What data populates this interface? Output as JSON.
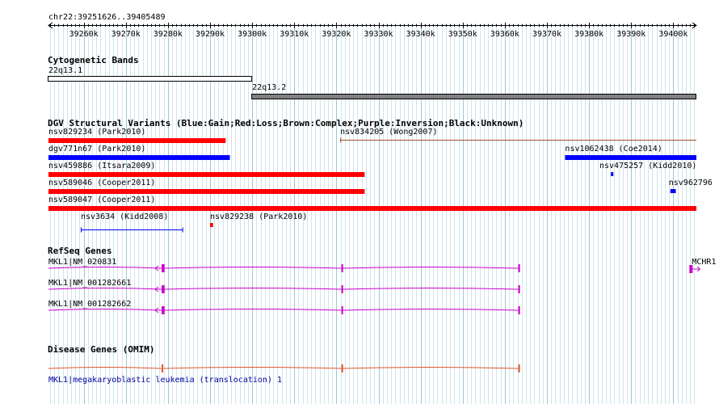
{
  "ruler": {
    "range_label": "chr22:39251626..39405489",
    "start": 39251626,
    "end": 39405489,
    "ticks": [
      "39260k",
      "39270k",
      "39280k",
      "39290k",
      "39300k",
      "39310k",
      "39320k",
      "39330k",
      "39340k",
      "39350k",
      "39360k",
      "39370k",
      "39380k",
      "39390k",
      "39400k"
    ],
    "tick_values": [
      39260000,
      39270000,
      39280000,
      39290000,
      39300000,
      39310000,
      39320000,
      39330000,
      39340000,
      39350000,
      39360000,
      39370000,
      39380000,
      39390000,
      39400000
    ]
  },
  "cytobands": {
    "title": "Cytogenetic Bands",
    "bands": [
      {
        "name": "22q13.1",
        "start": 39251626,
        "end": 39300000,
        "color": "#ffffff"
      },
      {
        "name": "22q13.2",
        "start": 39300000,
        "end": 39405489,
        "color": "#808080"
      }
    ]
  },
  "dgv": {
    "title": "DGV Structural Variants (Blue:Gain;Red:Loss;Brown:Complex;Purple:Inversion;Black:Unknown)",
    "colors": {
      "gain": "#0000ff",
      "loss": "#ff0000",
      "complex": "#a0522d",
      "unknown": "#000000"
    },
    "variants": [
      {
        "label": "nsv829234 (Park2010)",
        "start": 39251626,
        "end": 39293700,
        "type": "loss",
        "row": 0,
        "style": "bar"
      },
      {
        "label": "nsv834205 (Wong2007)",
        "start": 39320900,
        "end": 39405489,
        "type": "complex",
        "row": 0,
        "style": "line"
      },
      {
        "label": "dgv771n67 (Park2010)",
        "start": 39251626,
        "end": 39294700,
        "type": "gain",
        "row": 1,
        "style": "bar"
      },
      {
        "label": "nsv1062438 (Coe2014)",
        "start": 39374300,
        "end": 39405489,
        "type": "gain",
        "row": 1,
        "style": "bar"
      },
      {
        "label": "nsv459886 (Itsara2009)",
        "start": 39251626,
        "end": 39326700,
        "type": "loss",
        "row": 2,
        "style": "bar"
      },
      {
        "label": "nsv475257 (Kidd2010)",
        "start": 39385200,
        "end": 39385500,
        "type": "gain",
        "row": 2,
        "style": "bar"
      },
      {
        "label": "nsv589046 (Cooper2011)",
        "start": 39251626,
        "end": 39326700,
        "type": "loss",
        "row": 3,
        "style": "bar"
      },
      {
        "label": "nsv962796",
        "start": 39399300,
        "end": 39400600,
        "type": "gain",
        "row": 3,
        "style": "bar"
      },
      {
        "label": "nsv589047 (Cooper2011)",
        "start": 39251626,
        "end": 39405489,
        "type": "loss",
        "row": 4,
        "style": "bar"
      },
      {
        "label": "nsv3634 (Kidd2008)",
        "start": 39259300,
        "end": 39283600,
        "type": "gain",
        "row": 5,
        "style": "line"
      },
      {
        "label": "nsv829238 (Park2010)",
        "start": 39290000,
        "end": 39290700,
        "type": "loss",
        "row": 5,
        "style": "bar"
      }
    ]
  },
  "refseq": {
    "title": "RefSeq Genes",
    "color": "#cc00cc",
    "transcripts": [
      {
        "label": "MKL1|NM_020831",
        "start": 39251626,
        "end": 39363600,
        "exons": [
          [
            39278500,
            39279200
          ],
          [
            39321200,
            39321500
          ],
          [
            39363200,
            39363600
          ]
        ]
      },
      {
        "label": "MKL1|NM_001282661",
        "start": 39251626,
        "end": 39363600,
        "exons": [
          [
            39278500,
            39279200
          ],
          [
            39321200,
            39321500
          ],
          [
            39363200,
            39363600
          ]
        ]
      },
      {
        "label": "MKL1|NM_001282662",
        "start": 39251626,
        "end": 39363600,
        "exons": [
          [
            39278500,
            39279200
          ],
          [
            39321200,
            39321500
          ],
          [
            39363200,
            39363600
          ]
        ]
      }
    ],
    "other_gene": {
      "label": "MCHR1",
      "start": 39404600,
      "end": 39405489
    }
  },
  "omim": {
    "title": "Disease Genes (OMIM)",
    "color": "#e2562a",
    "gene": {
      "label": "MKL1|megakaryoblastic leukemia (translocation) 1",
      "start": 39251626,
      "end": 39363600,
      "exons": [
        [
          39278500,
          39279000
        ],
        [
          39321200,
          39321500
        ],
        [
          39363200,
          39363600
        ]
      ]
    }
  }
}
